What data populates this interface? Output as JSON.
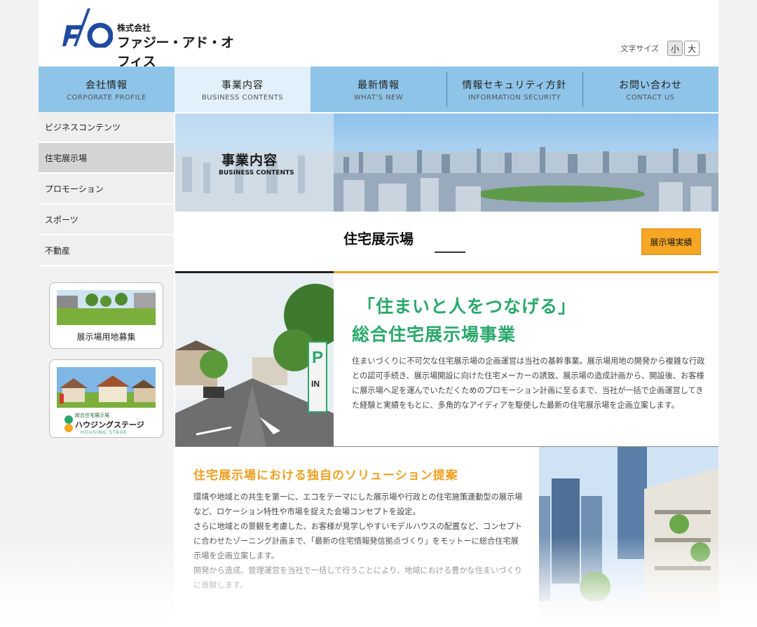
{
  "header": {
    "logo_mark": "F/O",
    "company_prefix": "株式会社",
    "company_name": "ファジー・アド・オフィス",
    "font_size_label": "文字サイズ",
    "font_small": "小",
    "font_large": "大"
  },
  "nav": {
    "items": [
      {
        "ja": "会社情報",
        "en": "CORPORATE PROFILE"
      },
      {
        "ja": "事業内容",
        "en": "BUSINESS CONTENTS"
      },
      {
        "ja": "最新情報",
        "en": "WHAT'S NEW"
      },
      {
        "ja": "情報セキュリティ方針",
        "en": "INFORMATION SECURITY"
      },
      {
        "ja": "お問い合わせ",
        "en": "CONTACT US"
      }
    ]
  },
  "sidebar": {
    "items": [
      {
        "label": "ビジネスコンテンツ"
      },
      {
        "label": "住宅展示場"
      },
      {
        "label": "プロモーション"
      },
      {
        "label": "スポーツ"
      },
      {
        "label": "不動産"
      }
    ],
    "banner1_label": "展示場用地募集",
    "banner2_small": "総合住宅展示場",
    "banner2_title": "ハウジングステージ",
    "banner2_en": "HOUSING STAGE"
  },
  "hero": {
    "title_ja": "事業内容",
    "title_en": "BUSINESS CONTENTS"
  },
  "section": {
    "title": "住宅展示場",
    "results_button": "展示場実績"
  },
  "block1": {
    "headline1": "「住まいと人をつなげる」",
    "headline2": "総合住宅展示場事業",
    "sign_letter": "P",
    "sign_in": "IN",
    "paragraph": "住まいづくりに不可欠な住宅展示場の企画運営は当社の基幹事業。展示場用地の開発から複雑な行政との認可手続き、展示場開設に向けた住宅メーカーの誘致、展示場の造成計画から、開設後、お客様に展示場へ足を運んでいただくためのプロモーション計画に至るまで、当社が一括で企画運営してきた経験と実績をもとに、多角的なアイディアを駆使した最新の住宅展示場を企画立案します。"
  },
  "block2": {
    "headline": "住宅展示場における独自のソリューション提案",
    "p1": "環境や地域との共生を第一に、エコをテーマにした展示場や行政との住宅施策連動型の展示場など、ロケーション特性や市場を捉えた会場コンセプトを設定。",
    "p2": "さらに地域との景観を考慮した、お客様が見学しやすいモデルハウスの配置など、コンセプトに合わせたゾーニング計画まで、「最新の住宅情報発信拠点づくり」をモットーに総合住宅展示場を企画立案します。",
    "p3": "開発から造成、管理運営を当社で一括して行うことにより、地域における豊かな住まいづくりに貢献します。"
  },
  "colors": {
    "nav": "#8ec4e8",
    "nav_active": "#e1f0fa",
    "accent_orange": "#f5a623",
    "accent_green": "#2aa86b",
    "logo_blue": "#1f4aa0"
  }
}
